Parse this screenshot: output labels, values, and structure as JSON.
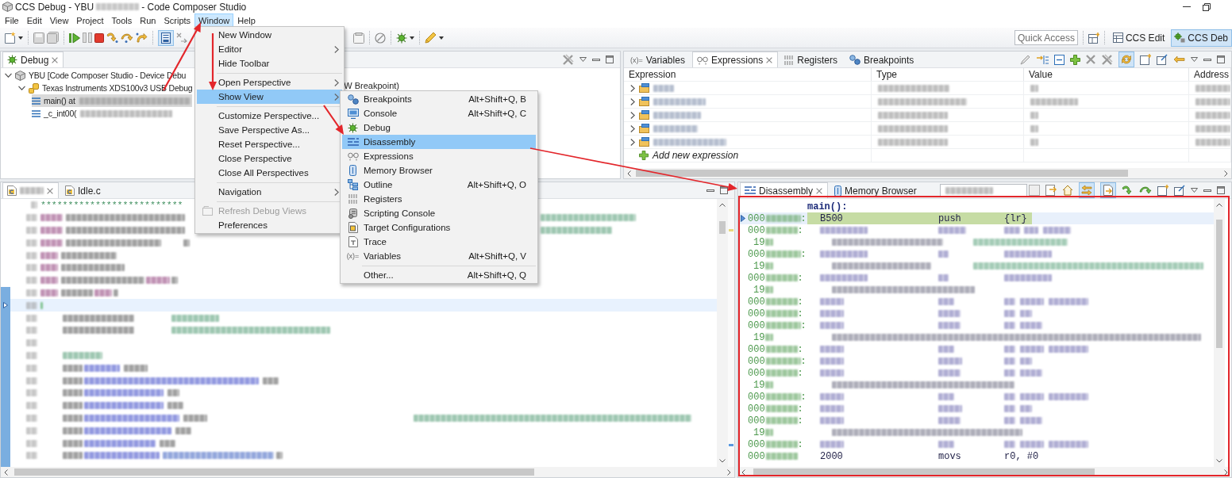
{
  "window": {
    "title_prefix": "CCS Debug - YBU",
    "title_suffix": "- Code Composer Studio"
  },
  "menu_bar": [
    {
      "label": "File",
      "selected": false
    },
    {
      "label": "Edit",
      "selected": false
    },
    {
      "label": "View",
      "selected": false
    },
    {
      "label": "Project",
      "selected": false
    },
    {
      "label": "Tools",
      "selected": false
    },
    {
      "label": "Run",
      "selected": false
    },
    {
      "label": "Scripts",
      "selected": false
    },
    {
      "label": "Window",
      "selected": true
    },
    {
      "label": "Help",
      "selected": false
    }
  ],
  "toolbar": {
    "quick_access": {
      "placeholder": "Quick Access"
    },
    "perspectives": [
      {
        "label": "CCS Edit",
        "selected": false
      },
      {
        "label": "CCS Deb",
        "selected": true
      }
    ]
  },
  "debug_view": {
    "tabs": [
      {
        "label": "Debug",
        "selected": true
      }
    ],
    "tree": [
      {
        "label": "YBU [Code Composer Studio - Device Debu",
        "expanded": true,
        "selected": false,
        "children": [
          {
            "label": "Texas Instruments XDS100v3 USB Debug",
            "trailing": "W Breakpoint)",
            "expanded": true,
            "selected": false,
            "children": [
              {
                "label": "main() at",
                "selected": true
              },
              {
                "label": "_c_int00(",
                "selected": false
              }
            ]
          }
        ]
      }
    ]
  },
  "expressions_view": {
    "tabs": [
      {
        "icon_text": "(x)=",
        "label": "Variables",
        "selected": false
      },
      {
        "label": "Expressions",
        "selected": true
      },
      {
        "label": "Registers",
        "selected": false
      },
      {
        "label": "Breakpoints",
        "selected": false
      }
    ],
    "columns": [
      "Expression",
      "Type",
      "Value",
      "Address"
    ],
    "rows": [
      {
        "expanded": false
      },
      {
        "expanded": false
      },
      {
        "expanded": false
      },
      {
        "expanded": false
      },
      {
        "expanded": false
      }
    ],
    "add_row": "Add new expression"
  },
  "editor": {
    "tabs": [
      {
        "kind": "blurred",
        "selected": true
      },
      {
        "kind": "named",
        "label": "Idle.c",
        "selected": false
      }
    ],
    "lines": [
      {
        "kind": "comment",
        "text": "**************************",
        "current": false
      },
      {
        "kind": "code",
        "current": false
      },
      {
        "kind": "code",
        "current": false
      },
      {
        "kind": "code",
        "current": false
      },
      {
        "kind": "code",
        "current": false
      },
      {
        "kind": "code",
        "current": false
      },
      {
        "kind": "code",
        "current": false
      },
      {
        "kind": "code",
        "current": false
      },
      {
        "kind": "code",
        "current": true
      },
      {
        "kind": "code",
        "current": false
      },
      {
        "kind": "code",
        "current": false
      },
      {
        "kind": "code",
        "current": false
      },
      {
        "kind": "code",
        "current": false
      },
      {
        "kind": "code",
        "current": false
      },
      {
        "kind": "code",
        "current": false
      },
      {
        "kind": "code",
        "current": false
      },
      {
        "kind": "code",
        "current": false
      },
      {
        "kind": "code",
        "current": false
      },
      {
        "kind": "code",
        "current": false
      },
      {
        "kind": "code",
        "current": false
      },
      {
        "kind": "code",
        "current": false
      }
    ]
  },
  "disassembly_view": {
    "tabs": [
      {
        "label": "Disassembly",
        "selected": true
      },
      {
        "label": "Memory Browser",
        "selected": false
      }
    ],
    "function_label": "main():",
    "rows": [
      {
        "kind": "instruction",
        "address": "000",
        "address_end": ":",
        "current": true,
        "opcode": "B500",
        "mnemonic": "push",
        "operands": "{lr}"
      },
      {
        "kind": "instruction",
        "address": "000",
        "address_end": ":",
        "current": false
      },
      {
        "kind": "source",
        "line": "19"
      },
      {
        "kind": "instruction",
        "address": "000",
        "address_end": ":",
        "current": false
      },
      {
        "kind": "source",
        "line": "19"
      },
      {
        "kind": "instruction",
        "address": "000",
        "address_end": ":",
        "current": false
      },
      {
        "kind": "source",
        "line": "19"
      },
      {
        "kind": "instruction",
        "address": "000",
        "address_end": ":",
        "current": false
      },
      {
        "kind": "instruction",
        "address": "000",
        "address_end": ":",
        "current": false
      },
      {
        "kind": "instruction",
        "address": "000",
        "address_end": ":",
        "current": false
      },
      {
        "kind": "source",
        "line": "19"
      },
      {
        "kind": "instruction",
        "address": "000",
        "address_end": ":",
        "current": false
      },
      {
        "kind": "instruction",
        "address": "000",
        "address_end": ":",
        "current": false
      },
      {
        "kind": "instruction",
        "address": "000",
        "address_end": ":",
        "current": false
      },
      {
        "kind": "source",
        "line": "19"
      },
      {
        "kind": "instruction",
        "address": "000",
        "address_end": ":",
        "current": false
      },
      {
        "kind": "instruction",
        "address": "000",
        "address_end": ":",
        "current": false
      },
      {
        "kind": "instruction",
        "address": "000",
        "address_end": ":",
        "current": false
      },
      {
        "kind": "source",
        "line": "19"
      },
      {
        "kind": "instruction",
        "address": "000",
        "address_end": ":",
        "current": false
      },
      {
        "kind": "instruction",
        "address": "000",
        "current": false,
        "opcode": "2000",
        "mnemonic": "movs",
        "operands": "r0, #0"
      }
    ]
  },
  "window_menu": {
    "items": [
      {
        "kind": "item",
        "label": "New Window",
        "submenu": false,
        "selected": false,
        "disabled": false
      },
      {
        "kind": "item",
        "label": "Editor",
        "submenu": true,
        "selected": false,
        "disabled": false
      },
      {
        "kind": "item",
        "label": "Hide Toolbar",
        "submenu": false,
        "selected": false,
        "disabled": false
      },
      {
        "kind": "separator"
      },
      {
        "kind": "item",
        "label": "Open Perspective",
        "submenu": true,
        "selected": false,
        "disabled": false
      },
      {
        "kind": "item",
        "label": "Show View",
        "submenu": true,
        "selected": true,
        "disabled": false
      },
      {
        "kind": "separator"
      },
      {
        "kind": "item",
        "label": "Customize Perspective...",
        "submenu": false,
        "selected": false,
        "disabled": false
      },
      {
        "kind": "item",
        "label": "Save Perspective As...",
        "submenu": false,
        "selected": false,
        "disabled": false
      },
      {
        "kind": "item",
        "label": "Reset Perspective...",
        "submenu": false,
        "selected": false,
        "disabled": false
      },
      {
        "kind": "item",
        "label": "Close Perspective",
        "submenu": false,
        "selected": false,
        "disabled": false
      },
      {
        "kind": "item",
        "label": "Close All Perspectives",
        "submenu": false,
        "selected": false,
        "disabled": false
      },
      {
        "kind": "separator"
      },
      {
        "kind": "item",
        "label": "Navigation",
        "submenu": true,
        "selected": false,
        "disabled": false
      },
      {
        "kind": "separator"
      },
      {
        "kind": "item",
        "label": "Refresh Debug Views",
        "submenu": false,
        "selected": false,
        "disabled": true
      },
      {
        "kind": "item",
        "label": "Preferences",
        "submenu": false,
        "selected": false,
        "disabled": false
      }
    ]
  },
  "show_view_submenu": {
    "items": [
      {
        "kind": "item",
        "label": "Breakpoints",
        "shortcut": "Alt+Shift+Q, B",
        "selected": false
      },
      {
        "kind": "item",
        "label": "Console",
        "shortcut": "Alt+Shift+Q, C",
        "selected": false
      },
      {
        "kind": "item",
        "label": "Debug",
        "selected": false
      },
      {
        "kind": "item",
        "label": "Disassembly",
        "selected": true
      },
      {
        "kind": "item",
        "label": "Expressions",
        "selected": false
      },
      {
        "kind": "item",
        "label": "Memory Browser",
        "selected": false
      },
      {
        "kind": "item",
        "label": "Outline",
        "shortcut": "Alt+Shift+Q, O",
        "selected": false
      },
      {
        "kind": "item",
        "label": "Registers",
        "selected": false
      },
      {
        "kind": "item",
        "label": "Scripting Console",
        "selected": false
      },
      {
        "kind": "item",
        "label": "Target Configurations",
        "selected": false
      },
      {
        "kind": "item",
        "label": "Trace",
        "selected": false
      },
      {
        "kind": "item",
        "label": "Variables",
        "icon_text": "(x)=",
        "shortcut": "Alt+Shift+Q, V",
        "selected": false
      },
      {
        "kind": "separator"
      },
      {
        "kind": "item",
        "label": "Other...",
        "shortcut": "Alt+Shift+Q, Q",
        "selected": false
      }
    ]
  }
}
